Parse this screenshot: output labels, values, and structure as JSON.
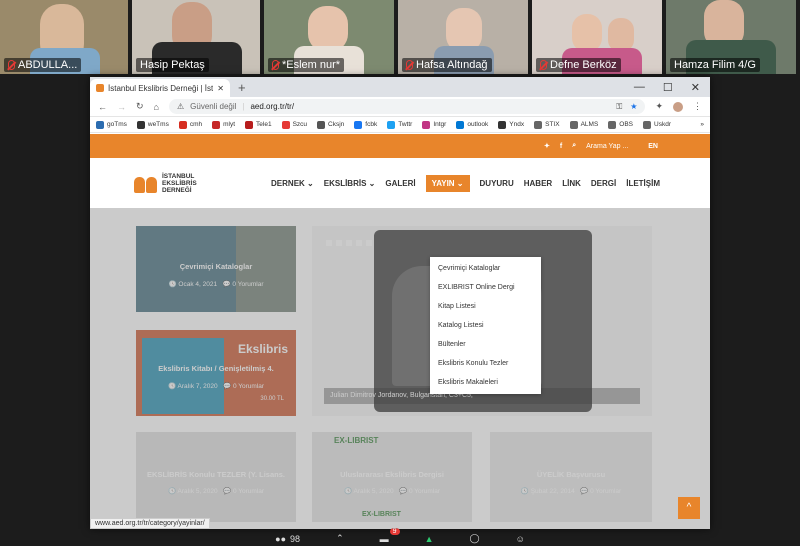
{
  "participants": [
    {
      "name": "ABDULLA...",
      "bg": "#9a8a6a"
    },
    {
      "name": "Hasip Pektaş",
      "bg": "#c9c2b8"
    },
    {
      "name": "*Eslem nur*",
      "bg": "#7d8a70"
    },
    {
      "name": "Hafsa Altındağ",
      "bg": "#b8b0a6"
    },
    {
      "name": "Defne Berköz",
      "bg": "#d8cfc9"
    },
    {
      "name": "Hamza Filim 4/G",
      "bg": "#6e7a6a"
    }
  ],
  "browser": {
    "tab_title": "İstanbul Ekslibris Derneği | İstanb",
    "new_tab": "+",
    "security": "Güvenli değil",
    "url": "aed.org.tr/tr/",
    "bookmarks": [
      {
        "label": "goTms",
        "color": "#2b6cb0"
      },
      {
        "label": "weTms",
        "color": "#333333"
      },
      {
        "label": "cmh",
        "color": "#d62d20"
      },
      {
        "label": "mlyt",
        "color": "#c62828"
      },
      {
        "label": "Tele1",
        "color": "#b71c1c"
      },
      {
        "label": "Szcu",
        "color": "#e53935"
      },
      {
        "label": "Cksjn",
        "color": "#555555"
      },
      {
        "label": "fcbk",
        "color": "#1877f2"
      },
      {
        "label": "Twttr",
        "color": "#1da1f2"
      },
      {
        "label": "Intgr",
        "color": "#c13584"
      },
      {
        "label": "outlook",
        "color": "#0078d4"
      },
      {
        "label": "Yndx",
        "color": "#333333"
      },
      {
        "label": "STIX",
        "color": "#666666"
      },
      {
        "label": "ALMS",
        "color": "#666666"
      },
      {
        "label": "OBS",
        "color": "#666666"
      },
      {
        "label": "Uskdr",
        "color": "#666666"
      }
    ],
    "more": "»"
  },
  "site": {
    "search_label": "Arama Yap ...",
    "lang": "EN",
    "logo_lines": [
      "İSTANBUL",
      "EKSLİBRİS",
      "DERNEĞİ"
    ],
    "nav": [
      "DERNEK",
      "EKSLİBRİS",
      "GALERİ",
      "YAYIN",
      "DUYURU",
      "HABER",
      "LİNK",
      "DERGİ",
      "İLETİŞİM"
    ],
    "dropdown": [
      "Çevrimiçi Kataloglar",
      "EXLIBRIST Online Dergi",
      "Kitap Listesi",
      "Katalog Listesi",
      "Bültenler",
      "Ekslibris Konulu Tezler",
      "Ekslibris Makaleleri"
    ],
    "cards": [
      {
        "title": "Çevrimiçi Kataloglar",
        "date": "Ocak 4, 2021",
        "comments": "0 Yorumlar"
      },
      {
        "title": "Ekslibris Kitabı / Genişletilmiş 4.",
        "date": "Aralık 7, 2020",
        "comments": "0 Yorumlar"
      },
      {
        "title": "EKSLİBRİS Konulu TEZLER (Y. Lisans.",
        "date": "Aralık 5, 2020",
        "comments": "0 Yorumlar"
      },
      {
        "title": "Uluslararası Ekslibris Dergisi",
        "date": "Aralık 5, 2020",
        "comments": "0 Yorumlar"
      },
      {
        "title": "ÜYELİK Başvurusu",
        "date": "Şubat 22, 2014",
        "comments": "0 Yorumlar"
      }
    ],
    "card_art": {
      "ekslibris_word": "Ekslibris",
      "ekslibris_price": "30.00 TL",
      "exlibrist_logo": "EX-LIBRIST",
      "exlibrist_sub": "EX-LIBRIST"
    },
    "slider_caption": "Julian Dimitrov Jordanov, Bulgaristan, C3+C5,",
    "status_url": "www.aed.org.tr/tr/category/yayinlar/",
    "to_top": "^"
  },
  "zoom": {
    "participants_count": "98",
    "chat_badge": "9"
  },
  "colors": {
    "accent": "#e8852b"
  }
}
